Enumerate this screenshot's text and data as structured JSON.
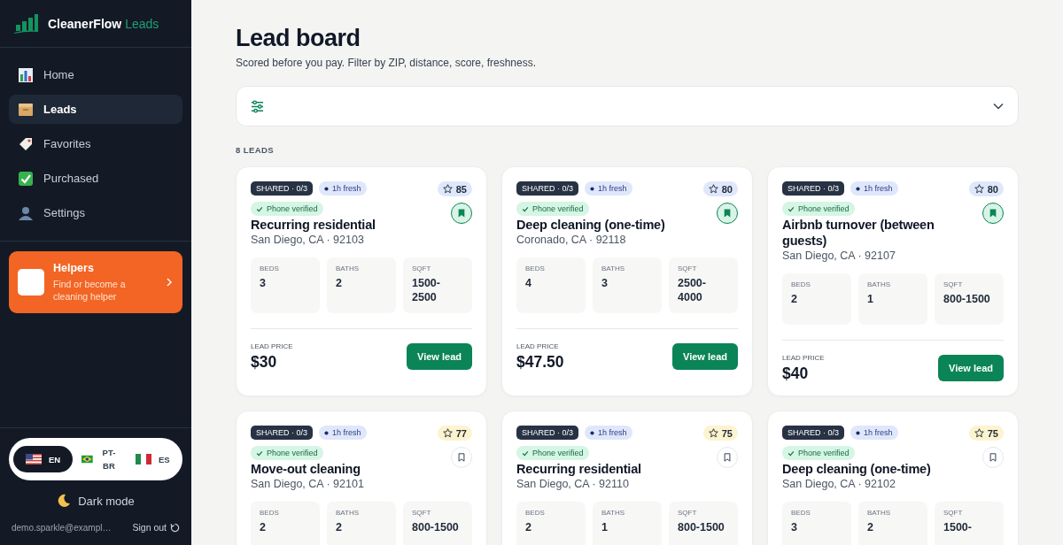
{
  "brand": {
    "name": "CleanerFlow",
    "accent": "Leads"
  },
  "nav": [
    {
      "label": "Home",
      "kind": "chart",
      "selected": false
    },
    {
      "label": "Leads",
      "kind": "box",
      "selected": true
    },
    {
      "label": "Favorites",
      "kind": "tag",
      "selected": false
    },
    {
      "label": "Purchased",
      "kind": "check",
      "selected": false
    },
    {
      "label": "Settings",
      "kind": "person",
      "selected": false
    }
  ],
  "helpers": {
    "title": "Helpers",
    "subtitle": "Find or become a cleaning helper"
  },
  "languages": [
    {
      "code": "EN",
      "kind": "us",
      "selected": true
    },
    {
      "code": "PT-BR",
      "kind": "br",
      "selected": false
    },
    {
      "code": "ES",
      "kind": "mx",
      "selected": false
    }
  ],
  "dark_mode": "Dark mode",
  "account": {
    "email": "demo.sparkle@exampl…",
    "sign_out": "Sign out"
  },
  "header": {
    "title": "Lead board",
    "subtitle": "Scored before you pay. Filter by ZIP, distance, score, freshness."
  },
  "count": "8 LEADS",
  "leads": [
    {
      "shared": "SHARED · 0/3",
      "fresh": "1h fresh",
      "score": "85",
      "color": "#dfe7fb",
      "verified": "Phone verified",
      "saved": true,
      "title": "Recurring residential",
      "location": "San Diego, CA · 92103",
      "stats": [
        {
          "label": "BEDS",
          "value": "3"
        },
        {
          "label": "BATHS",
          "value": "2"
        },
        {
          "label": "SQFT",
          "value": "1500-2500"
        }
      ],
      "price_label": "LEAD PRICE",
      "price": "$30",
      "action": "View lead"
    },
    {
      "shared": "SHARED · 0/3",
      "fresh": "1h fresh",
      "score": "80",
      "color": "#dfe7fb",
      "verified": "Phone verified",
      "saved": true,
      "title": "Deep cleaning (one-time)",
      "location": "Coronado, CA · 92118",
      "stats": [
        {
          "label": "BEDS",
          "value": "4"
        },
        {
          "label": "BATHS",
          "value": "3"
        },
        {
          "label": "SQFT",
          "value": "2500-4000"
        }
      ],
      "price_label": "LEAD PRICE",
      "price": "$47.50",
      "action": "View lead"
    },
    {
      "shared": "SHARED · 0/3",
      "fresh": "1h fresh",
      "score": "80",
      "color": "#dfe7fb",
      "verified": "Phone verified",
      "saved": true,
      "title": "Airbnb turnover (between guests)",
      "location": "San Diego, CA · 92107",
      "stats": [
        {
          "label": "BEDS",
          "value": "2"
        },
        {
          "label": "BATHS",
          "value": "1"
        },
        {
          "label": "SQFT",
          "value": "800-1500"
        }
      ],
      "price_label": "LEAD PRICE",
      "price": "$40",
      "action": "View lead"
    },
    {
      "shared": "SHARED · 0/3",
      "fresh": "1h fresh",
      "score": "77",
      "color": "#fcf3cf",
      "verified": "Phone verified",
      "saved": false,
      "title": "Move-out cleaning",
      "location": "San Diego, CA · 92101",
      "stats": [
        {
          "label": "BEDS",
          "value": "2"
        },
        {
          "label": "BATHS",
          "value": "2"
        },
        {
          "label": "SQFT",
          "value": "800-1500"
        }
      ]
    },
    {
      "shared": "SHARED · 0/3",
      "fresh": "1h fresh",
      "score": "75",
      "color": "#fcf3cf",
      "verified": "Phone verified",
      "saved": false,
      "title": "Recurring residential",
      "location": "San Diego, CA · 92110",
      "stats": [
        {
          "label": "BEDS",
          "value": "2"
        },
        {
          "label": "BATHS",
          "value": "1"
        },
        {
          "label": "SQFT",
          "value": "800-1500"
        }
      ]
    },
    {
      "shared": "SHARED · 0/3",
      "fresh": "1h fresh",
      "score": "75",
      "color": "#fcf3cf",
      "verified": "Phone verified",
      "saved": false,
      "title": "Deep cleaning (one-time)",
      "location": "San Diego, CA · 92102",
      "stats": [
        {
          "label": "BEDS",
          "value": "3"
        },
        {
          "label": "BATHS",
          "value": "2"
        },
        {
          "label": "SQFT",
          "value": "1500-"
        }
      ]
    }
  ]
}
